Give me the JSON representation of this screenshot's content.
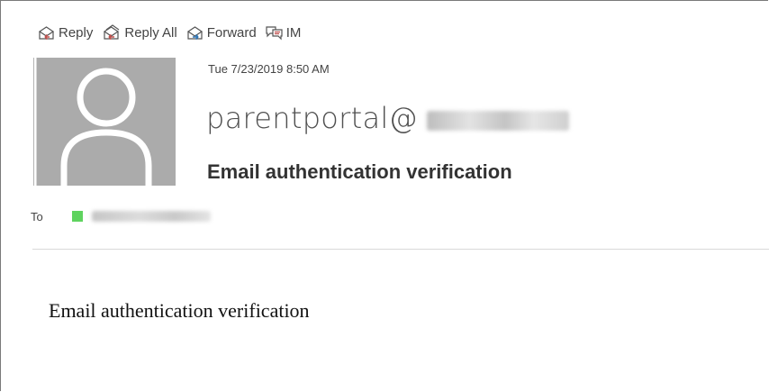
{
  "toolbar": {
    "reply_label": "Reply",
    "reply_all_label": "Reply All",
    "forward_label": "Forward",
    "im_label": "IM"
  },
  "message": {
    "timestamp": "Tue 7/23/2019 8:50 AM",
    "sender": "parentportal@",
    "subject": "Email authentication verification",
    "to_label": "To",
    "body": "Email authentication verification"
  },
  "colors": {
    "presence_available": "#5fd35f",
    "avatar_background": "#ababab",
    "reply_icon_accent": "#c0504d",
    "forward_icon_accent": "#2e75b6"
  },
  "icons": [
    "reply-icon",
    "reply-all-icon",
    "forward-icon",
    "im-icon",
    "person-silhouette-icon"
  ]
}
